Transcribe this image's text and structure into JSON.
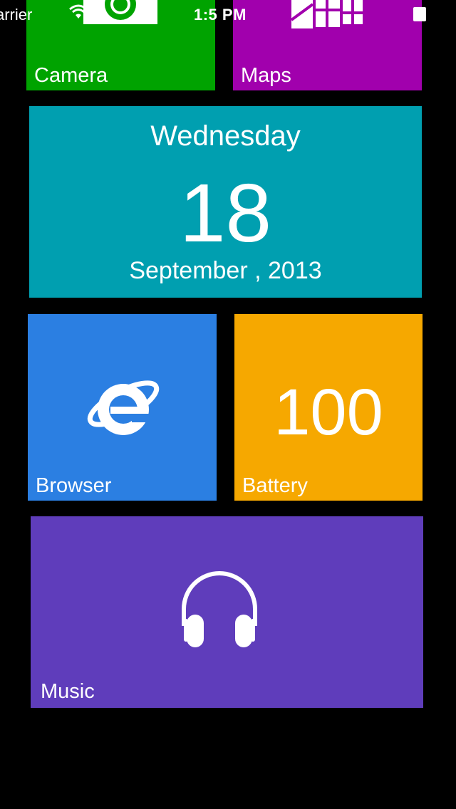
{
  "status_bar": {
    "carrier": "arrier",
    "time": "1:5  PM"
  },
  "tiles": {
    "camera": {
      "label": "Camera",
      "color": "#00a300"
    },
    "maps": {
      "label": "Maps",
      "color": "#a100ad"
    },
    "calendar": {
      "day": "Wednesday",
      "date": "18",
      "month_year": "September , 2013",
      "color": "#009fb0"
    },
    "browser": {
      "label": "Browser",
      "color": "#2b7fe2"
    },
    "battery": {
      "label": "Battery",
      "value": "100",
      "color": "#f6a800"
    },
    "music": {
      "label": "Music",
      "color": "#5f3dbb"
    }
  },
  "icons": {
    "camera": "camera-icon",
    "maps": "map-icon",
    "browser": "internet-explorer-icon",
    "music": "headphones-icon",
    "wifi": "wifi-icon",
    "battery": "battery-icon"
  }
}
